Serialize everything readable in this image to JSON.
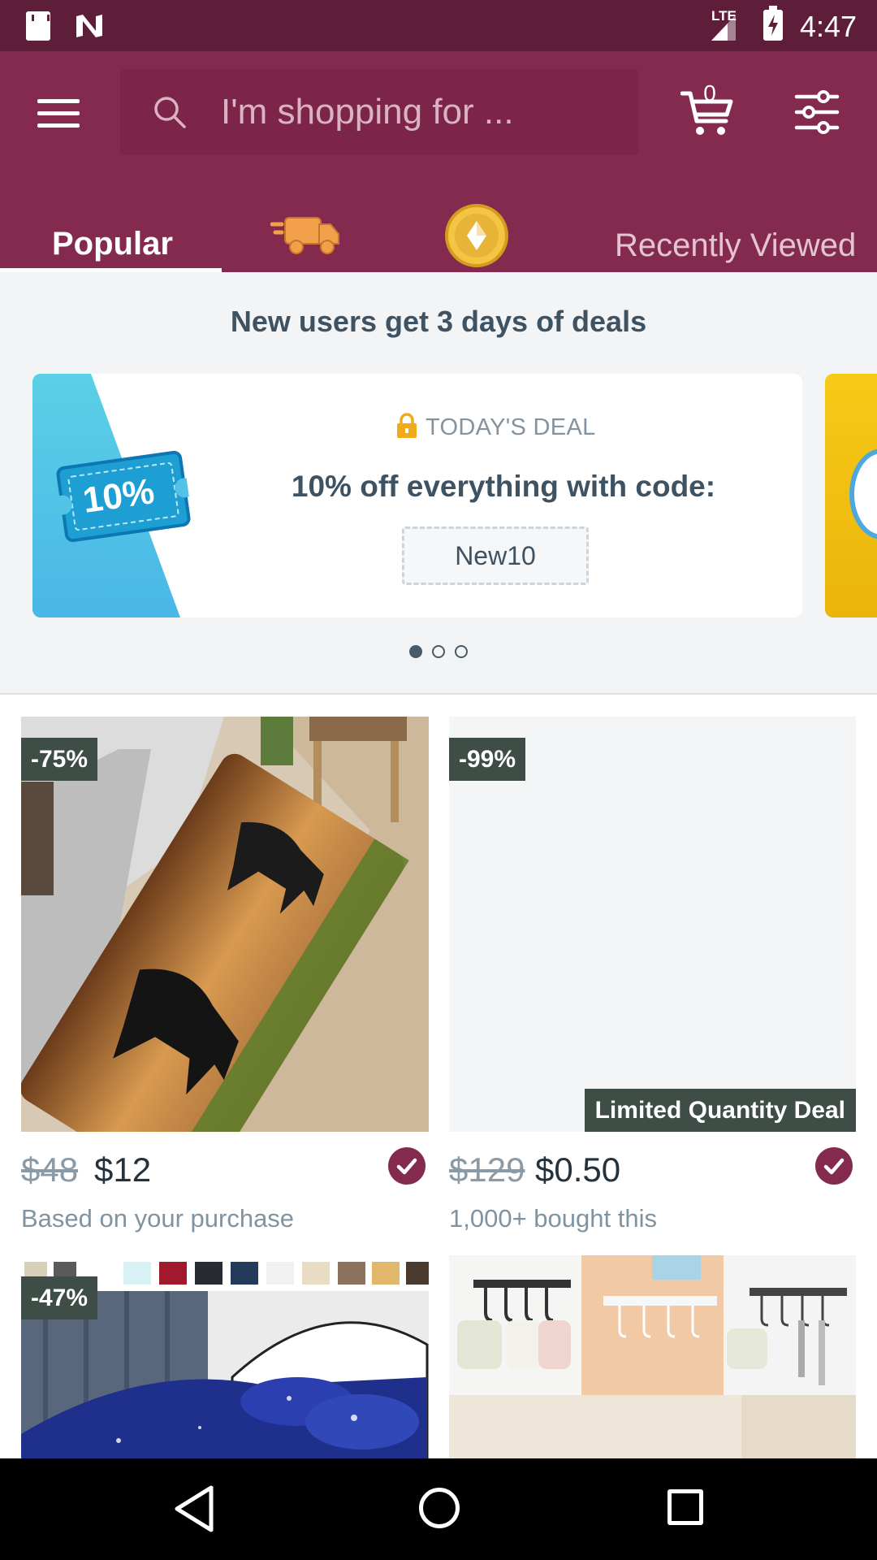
{
  "status_bar": {
    "network": "LTE",
    "time": "4:47"
  },
  "search": {
    "placeholder": "I'm shopping for ..."
  },
  "cart": {
    "count": "0"
  },
  "tabs": [
    {
      "label": "Popular",
      "active": true
    },
    {
      "icon": "delivery-truck-icon"
    },
    {
      "icon": "coin-icon"
    },
    {
      "label": "Recently Viewed"
    }
  ],
  "deals": {
    "title": "New users get 3 days of deals",
    "ticket_text": "10%",
    "tag": "TODAY'S DEAL",
    "headline": "10% off everything with code:",
    "code": "New10",
    "page_count": 3,
    "active_page": 1
  },
  "products": [
    {
      "badge": "-75%",
      "old_price": "$48",
      "price": "$12",
      "subtitle": "Based on your purchase",
      "verified": true
    },
    {
      "badge": "-99%",
      "overlay": "Limited Quantity Deal",
      "old_price": "$129",
      "price": "$0.50",
      "subtitle": "1,000+ bought this",
      "verified": true
    },
    {
      "badge": "-47%"
    },
    {}
  ],
  "colors": {
    "brand": "#852a4f",
    "status_bar": "#5e1e3a",
    "badge_bg": "#3e4d45"
  }
}
